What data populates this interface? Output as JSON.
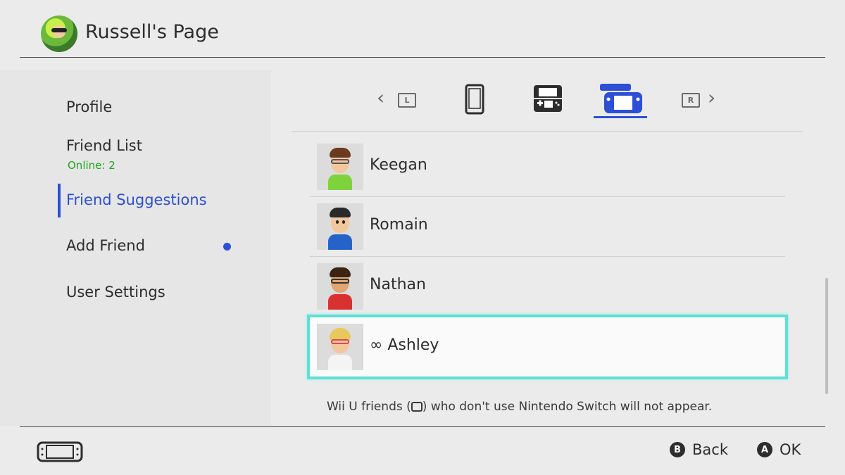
{
  "header": {
    "title": "Russell's Page"
  },
  "sidebar": {
    "items": [
      {
        "label": "Profile"
      },
      {
        "label": "Friend List",
        "sub": "Online: 2"
      },
      {
        "label": "Friend Suggestions",
        "active": true
      },
      {
        "label": "Add Friend",
        "notification": true
      },
      {
        "label": "User Settings"
      }
    ]
  },
  "tabs": {
    "left_key": "L",
    "right_key": "R",
    "items": [
      {
        "icon": "smart-device-icon"
      },
      {
        "icon": "nintendo-3ds-icon"
      },
      {
        "icon": "wii-u-icon",
        "selected": true
      }
    ]
  },
  "friends": [
    {
      "name": "Keegan"
    },
    {
      "name": "Romain"
    },
    {
      "name": "Nathan"
    },
    {
      "name": "∞ Ashley",
      "selected": true
    }
  ],
  "footnote": {
    "before": "Wii U friends (",
    "after": ") who don't use Nintendo Switch will not appear."
  },
  "footer": {
    "back_key": "B",
    "back_label": "Back",
    "ok_key": "A",
    "ok_label": "OK"
  },
  "colors": {
    "accent": "#2d4fd6",
    "online": "#1ea51e",
    "selection": "#5fe0d6"
  }
}
